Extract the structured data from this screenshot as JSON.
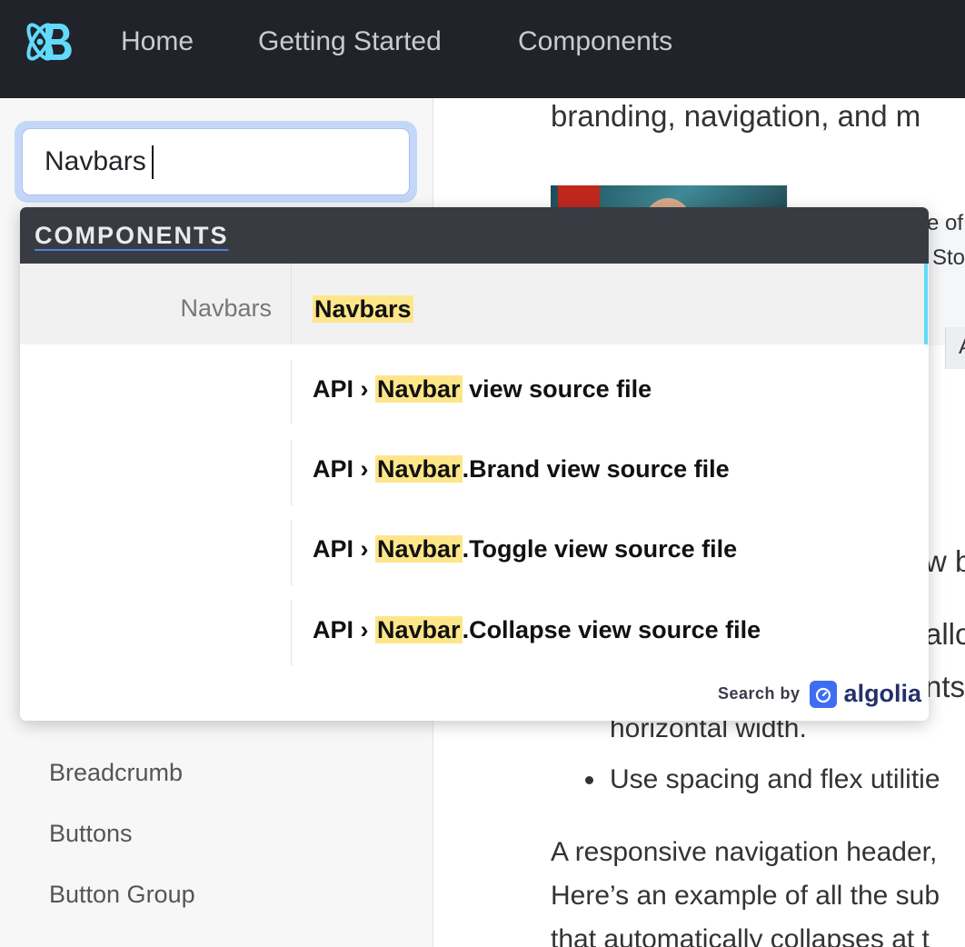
{
  "navbar": {
    "brand_icon": "react-bootstrap-logo-icon",
    "links": [
      "Home",
      "Getting Started",
      "Components"
    ]
  },
  "sidebar": {
    "search_value": "Navbars",
    "items": [
      "Breadcrumb",
      "Buttons",
      "Button Group"
    ]
  },
  "content": {
    "line_top": "branding, navigation, and m",
    "card_text_1": "e of",
    "card_text_2": "Sto",
    "card_button_letter": "A",
    "frag_1": "w b",
    "frag_2": "allo",
    "frag_3": "nts",
    "bullet_1_cont": "horizontal width.",
    "bullet_2": "Use spacing and flex utilitie",
    "para_line_1": "A responsive navigation header,",
    "para_line_2": "Here’s an example of all the sub",
    "para_line_3": "that automatically collapses at t"
  },
  "search_dropdown": {
    "category": "COMPONENTS",
    "top_hit": {
      "subcategory": "Navbars",
      "title": "Navbars"
    },
    "results": [
      {
        "prefix": "API › ",
        "highlight": "Navbar",
        "suffix": " view source file"
      },
      {
        "prefix": "API › ",
        "highlight": "Navbar",
        "suffix": ".Brand view source file"
      },
      {
        "prefix": "API › ",
        "highlight": "Navbar",
        "suffix": ".Toggle view source file"
      },
      {
        "prefix": "API › ",
        "highlight": "Navbar",
        "suffix": ".Collapse view source file"
      }
    ],
    "powered_by_label": "Search by",
    "powered_by_brand": "algolia",
    "powered_by_icon": "algolia-stopwatch-icon"
  },
  "colors": {
    "navbar_bg": "#20232a",
    "brand_accent": "#61dafb",
    "highlight": "#fde68a",
    "dropdown_header": "#393b42",
    "algolia_blue": "#3f6df2"
  }
}
